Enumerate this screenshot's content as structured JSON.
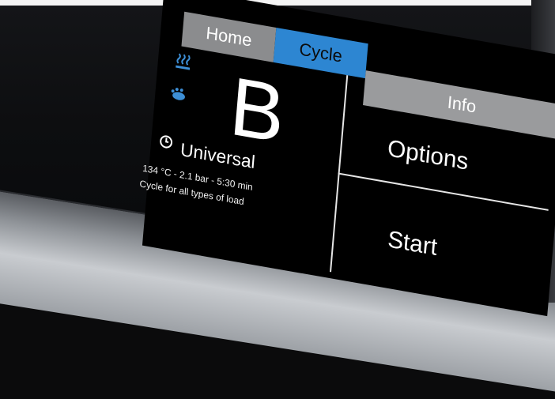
{
  "tabs": {
    "home": "Home",
    "cycle": "Cycle",
    "info": "Info"
  },
  "program": {
    "letter": "B",
    "name": "Universal",
    "parameters": "134 °C - 2.1 bar - 5:30 min",
    "description": "Cycle for all types of load"
  },
  "actions": {
    "options": "Options",
    "start": "Start"
  },
  "icons": [
    "steam-icon",
    "hand-icon",
    "clock-icon"
  ],
  "colors": {
    "active_tab": "#2d86d2",
    "inactive_tab": "#8b8c8e",
    "icon_accent": "#3d8fd6",
    "screen_background": "#000000",
    "text": "#ffffff"
  }
}
